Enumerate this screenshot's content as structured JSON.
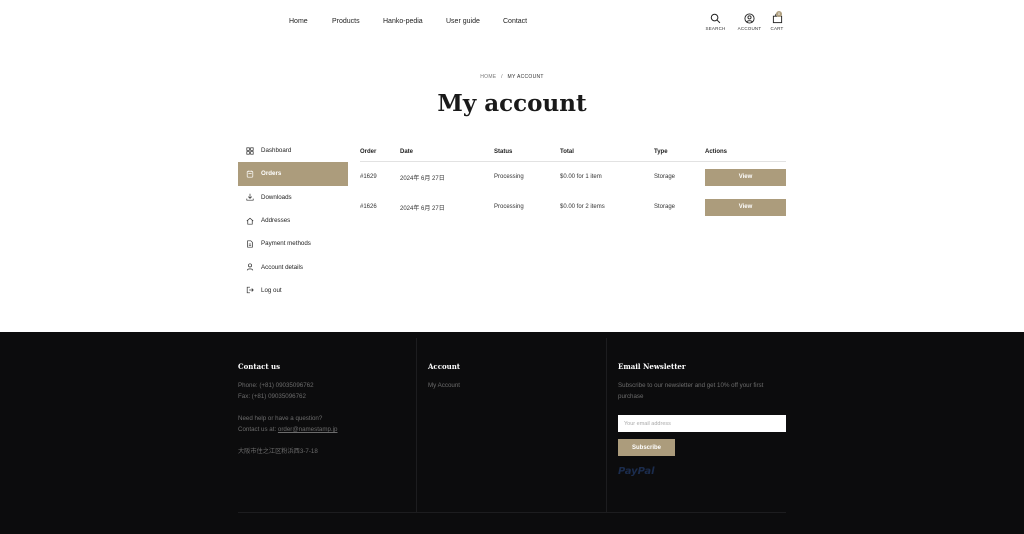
{
  "nav": {
    "links": [
      "Home",
      "Products",
      "Hanko-pedia",
      "User guide",
      "Contact"
    ],
    "icons": {
      "search": {
        "label": "SEARCH",
        "icon": "search-icon"
      },
      "account": {
        "label": "ACCOUNT",
        "icon": "user-circle-icon"
      },
      "cart": {
        "label": "CART",
        "icon": "cart-icon",
        "count": "0"
      }
    }
  },
  "breadcrumb": {
    "home": "HOME",
    "sep": "/",
    "current": "MY ACCOUNT"
  },
  "page_title": "My account",
  "sidebar": {
    "items": [
      {
        "label": "Dashboard",
        "icon": "dashboard-icon"
      },
      {
        "label": "Orders",
        "icon": "orders-icon",
        "active": true
      },
      {
        "label": "Downloads",
        "icon": "download-icon"
      },
      {
        "label": "Addresses",
        "icon": "home-icon"
      },
      {
        "label": "Payment methods",
        "icon": "document-icon"
      },
      {
        "label": "Account details",
        "icon": "user-icon"
      },
      {
        "label": "Log out",
        "icon": "logout-icon"
      }
    ]
  },
  "orders": {
    "headers": [
      "Order",
      "Date",
      "Status",
      "Total",
      "Type",
      "Actions"
    ],
    "rows": [
      {
        "order": "#1629",
        "date": "2024年 6月 27日",
        "status": "Processing",
        "total": "$0.00 for 1 item",
        "type": "Storage",
        "action": "View"
      },
      {
        "order": "#1626",
        "date": "2024年 6月 27日",
        "status": "Processing",
        "total": "$0.00 for 2 items",
        "type": "Storage",
        "action": "View"
      }
    ]
  },
  "footer": {
    "contact": {
      "heading": "Contact us",
      "phone": "Phone: (+81) 09035096762",
      "fax": "Fax: (+81) 09035096762",
      "help": "Need help or have a question?",
      "contact_prefix": "Contact us at: ",
      "email": "order@namestamp.jp",
      "address": "大阪市住之江区粉浜西3-7-18"
    },
    "account": {
      "heading": "Account",
      "link": "My Account"
    },
    "newsletter": {
      "heading": "Email Newsletter",
      "text": "Subscribe to our newsletter and get 10% off your first purchase",
      "placeholder": "Your email address",
      "button": "Subscribe",
      "paypal": "PayPal"
    }
  },
  "colors": {
    "accent": "#ac9c7c",
    "footer_bg": "#0c0c0d"
  }
}
